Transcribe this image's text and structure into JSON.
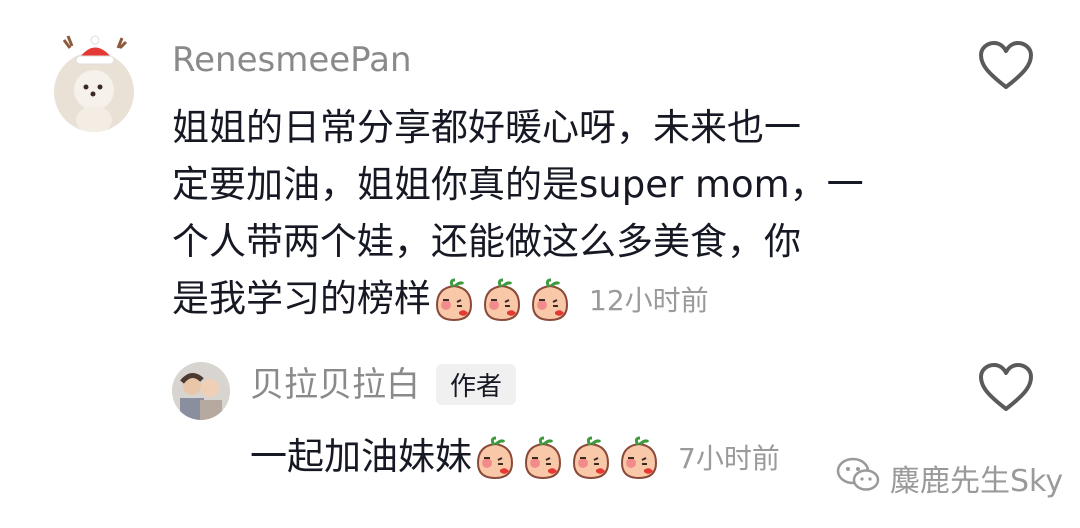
{
  "comment": {
    "username": "RenesmeePan",
    "text_lines": [
      "姐姐的日常分享都好暖心呀，未来也一",
      "定要加油，姐姐你真的是super mom，一",
      "个人带两个娃，还能做这么多美食，你",
      "是我学习的榜样"
    ],
    "emoji_icons": [
      "peach-blush-icon",
      "peach-blush-icon",
      "peach-blush-icon"
    ],
    "time": "12小时前"
  },
  "reply": {
    "username": "贝拉贝拉白",
    "author_badge": "作者",
    "text": "一起加油妹妹",
    "emoji_icons": [
      "peach-blush-icon",
      "peach-blush-icon",
      "peach-blush-icon",
      "peach-blush-icon"
    ],
    "time": "7小时前"
  },
  "watermark": {
    "icon": "wechat-icon",
    "text": "麋鹿先生Sky"
  }
}
